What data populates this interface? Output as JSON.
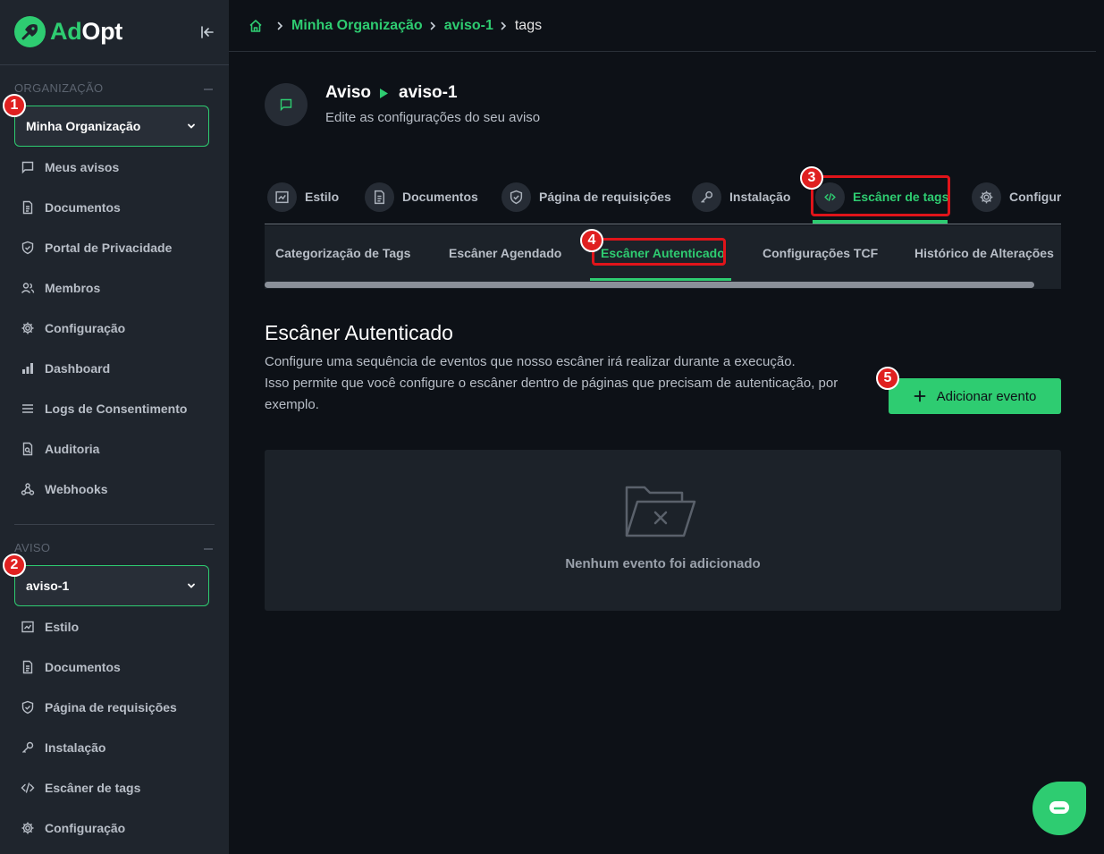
{
  "app": {
    "logo_prefix": "Ad",
    "logo_suffix": "Opt",
    "brand_color": "#2ecc71"
  },
  "sidebar": {
    "org_section": "ORGANIZAÇÃO",
    "org_select": "Minha Organização",
    "org_items": [
      {
        "label": "Meus avisos",
        "icon": "message-square-icon"
      },
      {
        "label": "Documentos",
        "icon": "file-text-icon"
      },
      {
        "label": "Portal de Privacidade",
        "icon": "shield-check-icon"
      },
      {
        "label": "Membros",
        "icon": "users-icon"
      },
      {
        "label": "Configuração",
        "icon": "gear-icon"
      },
      {
        "label": "Dashboard",
        "icon": "bar-chart-icon"
      },
      {
        "label": "Logs de Consentimento",
        "icon": "list-icon"
      },
      {
        "label": "Auditoria",
        "icon": "audit-icon"
      },
      {
        "label": "Webhooks",
        "icon": "webhook-icon"
      }
    ],
    "notice_section": "AVISO",
    "notice_select": "aviso-1",
    "notice_items": [
      {
        "label": "Estilo",
        "icon": "style-icon"
      },
      {
        "label": "Documentos",
        "icon": "file-text-icon"
      },
      {
        "label": "Página de requisições",
        "icon": "shield-check-icon"
      },
      {
        "label": "Instalação",
        "icon": "key-icon"
      },
      {
        "label": "Escâner de tags",
        "icon": "code-icon"
      },
      {
        "label": "Configuração",
        "icon": "gear-icon"
      }
    ]
  },
  "breadcrumb": {
    "org": "Minha Organização",
    "notice": "aviso-1",
    "current": "tags"
  },
  "header": {
    "title_a": "Aviso",
    "title_b": "aviso-1",
    "subtitle": "Edite as configurações do seu aviso"
  },
  "tabs": [
    {
      "label": "Estilo",
      "icon": "style-icon"
    },
    {
      "label": "Documentos",
      "icon": "file-text-icon"
    },
    {
      "label": "Página de requisições",
      "icon": "shield-check-icon"
    },
    {
      "label": "Instalação",
      "icon": "key-icon"
    },
    {
      "label": "Escâner de tags",
      "icon": "code-icon",
      "active": true
    },
    {
      "label": "Configurações",
      "icon": "gear-icon"
    }
  ],
  "subtabs": [
    "Categorização de Tags",
    "Escâner Agendado",
    "Escâner Autenticado",
    "Configurações TCF",
    "Histórico de Alterações"
  ],
  "section": {
    "title": "Escâner Autenticado",
    "desc_line1": "Configure uma sequência de eventos que nosso escâner irá realizar durante a execução.",
    "desc_line2": "Isso permite que você configure o escâner dentro de páginas que precisam de autenticação, por exemplo.",
    "add_button": "Adicionar evento",
    "empty_message": "Nenhum evento foi adicionado"
  },
  "annotations": [
    "1",
    "2",
    "3",
    "4",
    "5"
  ]
}
